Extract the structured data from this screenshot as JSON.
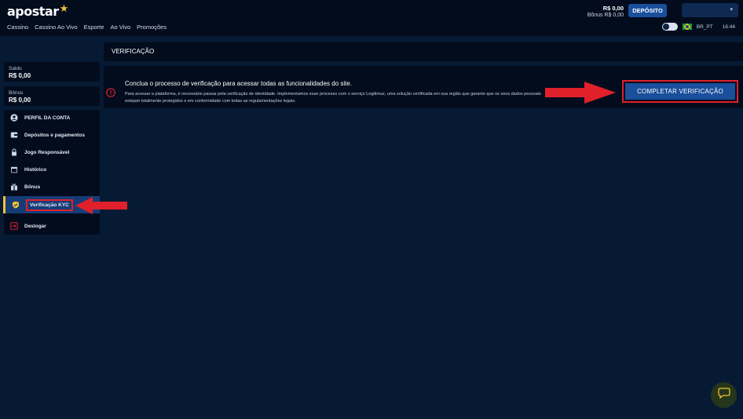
{
  "brand": {
    "name": "apostar"
  },
  "nav": [
    "Cassino",
    "Cassino Ao Vivo",
    "Esporte",
    "Ao Vivo",
    "Promoções"
  ],
  "header": {
    "balance": "R$ 0,00",
    "bonus": "Bônus R$ 0,00",
    "deposit_label": "DEPÓSITO",
    "language": "BR_PT",
    "time": "16:44"
  },
  "sidebar": {
    "saldo_label": "Saldo",
    "saldo_value": "R$ 0,00",
    "bonus_label": "Bônus",
    "bonus_value": "R$ 0,00",
    "items": [
      {
        "label": "PERFIL DA CONTA",
        "icon": "user-circle-icon"
      },
      {
        "label": "Depósitos e pagamentos",
        "icon": "wallet-icon"
      },
      {
        "label": "Jogo Responsável",
        "icon": "lock-icon"
      },
      {
        "label": "Histórico",
        "icon": "calendar-icon"
      },
      {
        "label": "Bônus",
        "icon": "gift-icon"
      },
      {
        "label": "Verificação KYC",
        "icon": "shield-icon",
        "active": true
      },
      {
        "label": "Deslogar",
        "icon": "logout-icon"
      }
    ]
  },
  "page": {
    "title": "VERIFICAÇÃO",
    "alert_heading": "Conclua o processo de verificação para acessar todas as funcionalidades do site.",
    "alert_description": "Para acessar a plataforma, é necessário passar pela verificação de identidade. Implementamos esse processo com o serviço Legitimuz, uma solução certificada em sua região que garante que os seus dados pessoais estejam totalmente protegidos e em conformidade com todas as regulamentações legais.",
    "complete_button": "COMPLETAR VERIFICAÇÃO"
  },
  "colors": {
    "accent": "#1a4f9c",
    "highlight": "#e0202a",
    "gold": "#f2c230",
    "background": "#071a33",
    "panel": "#020c1d"
  }
}
